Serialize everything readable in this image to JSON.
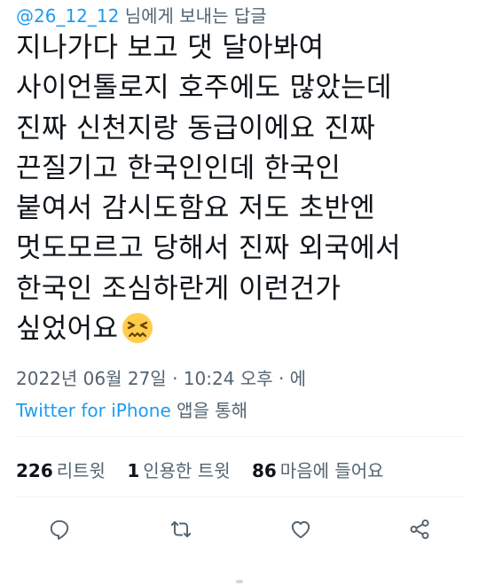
{
  "reply_context": {
    "handle": "@26_12_12",
    "suffix": "님에게 보내는 답글"
  },
  "tweet": {
    "lines": [
      "지나가다 보고 댓 달아봐여",
      "사이언톨로지 호주에도 많았는데",
      "진짜 신천지랑 동급이에요 진짜",
      "끈질기고 한국인인데 한국인",
      "붙여서 감시도함요 저도 초반엔",
      "멋도모르고 당해서 진짜 외국에서",
      "한국인 조심하란게 이런건가",
      "싶었어요"
    ],
    "emoji": "confounded-face-emoji"
  },
  "meta": {
    "date": "2022년 06월 27일",
    "sep1": "·",
    "time": "10:24 오후",
    "sep2": "·",
    "extra": "에"
  },
  "source": {
    "app": "Twitter for iPhone",
    "suffix": "앱을 통해"
  },
  "stats": {
    "retweets_count": "226",
    "retweets_label": "리트윗",
    "quotes_count": "1",
    "quotes_label": "인용한 트윗",
    "likes_count": "86",
    "likes_label": "마음에 들어요"
  },
  "actions": {
    "reply": "reply-icon",
    "retweet": "retweet-icon",
    "like": "heart-icon",
    "share": "share-icon"
  },
  "colors": {
    "accent": "#1d9bf0",
    "text": "#0f1419",
    "secondary": "#536471",
    "divider": "#eff3f4"
  }
}
